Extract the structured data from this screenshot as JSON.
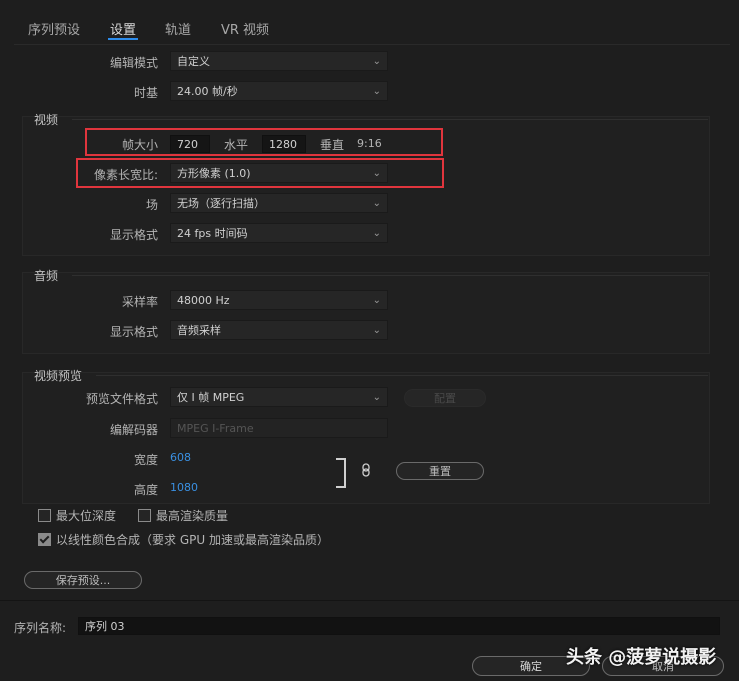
{
  "tabs": [
    "序列预设",
    "设置",
    "轨道",
    "VR 视频"
  ],
  "active_tab": "设置",
  "editing_mode": {
    "label": "编辑模式",
    "value": "自定义"
  },
  "timebase": {
    "label": "时基",
    "value": "24.00  帧/秒"
  },
  "video": {
    "title": "视频",
    "frame_size_label": "帧大小",
    "width_value": "720",
    "horizontal_label": "水平",
    "height_value": "1280",
    "vertical_label": "垂直",
    "aspect": "9:16",
    "pixel_aspect_label": "像素长宽比:",
    "pixel_aspect_value": "方形像素 (1.0)",
    "field_label": "场",
    "field_value": "无场（逐行扫描）",
    "display_label": "显示格式",
    "display_value": "24 fps 时间码"
  },
  "audio": {
    "title": "音频",
    "sample_rate_label": "采样率",
    "sample_rate_value": "48000 Hz",
    "display_label": "显示格式",
    "display_value": "音频采样"
  },
  "video_preview": {
    "title": "视频预览",
    "file_format_label": "预览文件格式",
    "file_format_value": "仅 I 帧 MPEG",
    "config_button": "配置",
    "codec_label": "编解码器",
    "codec_value": "MPEG I-Frame",
    "width_label": "宽度",
    "width_value": "608",
    "height_label": "高度",
    "height_value": "1080",
    "reset_button": "重置"
  },
  "checkboxes": {
    "max_bit_depth": "最大位深度",
    "max_render_quality": "最高渲染质量",
    "linear_color": "以线性颜色合成（要求 GPU 加速或最高渲染品质）"
  },
  "save_preset_button": "保存预设...",
  "sequence_name_label": "序列名称:",
  "sequence_name_value": "序列 03",
  "ok_button": "确定",
  "cancel_button": "取消",
  "watermark": "头条 @菠萝说摄影"
}
